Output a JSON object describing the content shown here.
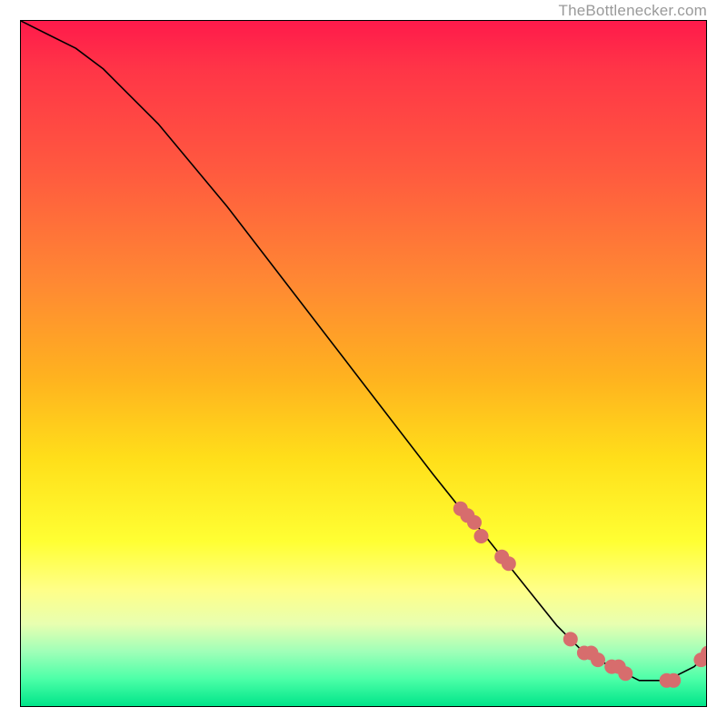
{
  "watermark": "TheBottlenecker.com",
  "chart_data": {
    "type": "line",
    "title": "",
    "xlabel": "",
    "ylabel": "",
    "xlim": [
      0,
      100
    ],
    "ylim": [
      0,
      100
    ],
    "grid": false,
    "background_gradient": {
      "orientation": "vertical",
      "stops": [
        {
          "pos": 0.0,
          "color": "#ff1a4b"
        },
        {
          "pos": 0.22,
          "color": "#ff5a3f"
        },
        {
          "pos": 0.5,
          "color": "#ffb21f"
        },
        {
          "pos": 0.76,
          "color": "#ffff33"
        },
        {
          "pos": 0.92,
          "color": "#a0ffb8"
        },
        {
          "pos": 1.0,
          "color": "#00e58a"
        }
      ]
    },
    "series": [
      {
        "name": "curve",
        "color": "#000000",
        "x": [
          0,
          4,
          8,
          12,
          20,
          30,
          40,
          50,
          60,
          64,
          66,
          70,
          74,
          78,
          80,
          82,
          84,
          86,
          88,
          90,
          92,
          94,
          96,
          98,
          100
        ],
        "y": [
          100,
          98,
          96,
          93,
          85,
          73,
          60,
          47,
          34,
          29,
          27,
          22,
          17,
          12,
          10,
          8,
          7,
          6,
          5,
          4,
          4,
          4,
          5,
          6,
          8
        ]
      }
    ],
    "markers": [
      {
        "name": "dots",
        "color": "#d76d6d",
        "radius": 8,
        "x": [
          64,
          65,
          66,
          67,
          70,
          71,
          80,
          82,
          83,
          84,
          86,
          87,
          88,
          94,
          95,
          99,
          100
        ],
        "y": [
          29,
          28,
          27,
          25,
          22,
          21,
          10,
          8,
          8,
          7,
          6,
          6,
          5,
          4,
          4,
          7,
          8
        ]
      }
    ]
  }
}
